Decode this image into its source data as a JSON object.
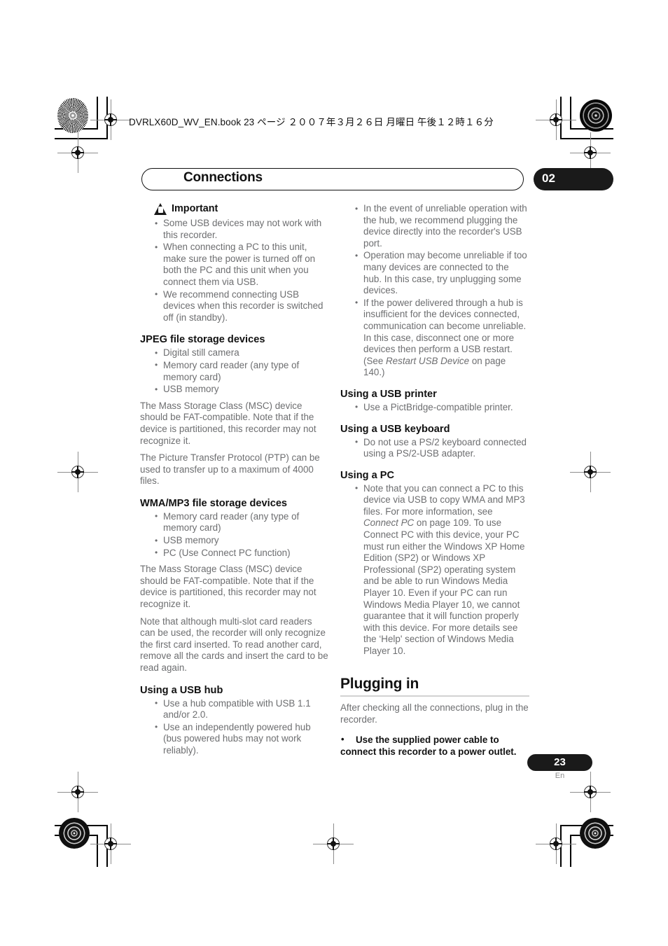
{
  "file_header": "DVRLX60D_WV_EN.book  23 ページ  ２００７年３月２６日   月曜日   午後１２時１６分",
  "chapter": {
    "title": "Connections",
    "number": "02"
  },
  "left_column": {
    "important": {
      "icon": "warning-triangle-icon",
      "label": "Important",
      "bullets": [
        "Some USB devices may not work with this recorder.",
        "When connecting a PC to this unit, make sure the power is turned off on both the PC and this unit when you connect them via USB.",
        "We recommend connecting USB devices when this recorder is switched off (in standby)."
      ]
    },
    "jpeg_section": {
      "heading": "JPEG file storage devices",
      "bullets": [
        "Digital still camera",
        "Memory card reader (any type of memory card)",
        "USB memory"
      ],
      "paragraphs": [
        "The Mass Storage Class (MSC) device should be FAT-compatible. Note that if the device is partitioned, this recorder may not recognize it.",
        "The Picture Transfer Protocol (PTP) can be used to transfer up to a maximum of 4000 files."
      ]
    },
    "wma_section": {
      "heading": "WMA/MP3 file storage devices",
      "bullets": [
        "Memory card reader (any type of memory card)",
        "USB memory",
        "PC (Use Connect PC function)"
      ],
      "paragraphs": [
        "The Mass Storage Class (MSC) device should be FAT-compatible. Note that if the device is partitioned, this recorder may not recognize it.",
        "Note that although multi-slot card readers can be used, the recorder will only recognize the first card inserted. To read another card, remove all the cards and insert the card to be read again."
      ]
    },
    "hub_section": {
      "heading": "Using a USB hub",
      "bullets": [
        "Use a hub compatible with USB 1.1 and/or 2.0.",
        "Use an independently powered hub (bus powered hubs may not work reliably)."
      ]
    }
  },
  "right_column": {
    "hub_bullets": [
      "In the event of unreliable operation with the hub, we recommend plugging the device directly into the recorder's USB port.",
      "Operation may become unreliable if too many devices are connected to the hub. In this case, try unplugging some devices."
    ],
    "hub_bullet_restart": {
      "text_before": "If the power delivered through a hub is insufficient for the devices connected, communication can become unreliable. In this case, disconnect one or more devices then perform a USB restart. (See ",
      "italic_ref": "Restart USB Device",
      "text_after": " on page 140.)"
    },
    "printer_section": {
      "heading": "Using a USB printer",
      "bullets": [
        "Use a PictBridge-compatible printer."
      ]
    },
    "keyboard_section": {
      "heading": "Using a USB keyboard",
      "bullets": [
        "Do not use a PS/2 keyboard connected using a PS/2-USB adapter."
      ]
    },
    "pc_section": {
      "heading": "Using a PC",
      "bullet": {
        "text_before": "Note that you can connect a PC to this device via USB to copy WMA and MP3 files. For more information, see ",
        "italic_ref": "Connect PC",
        "text_after": " on page 109. To use Connect PC with this device, your PC must run either the Windows XP Home Edition (SP2) or Windows XP Professional (SP2) operating system and be able to run Windows Media Player 10. Even if your PC can run Windows Media Player 10, we cannot guarantee that it will function properly with this device. For more details see the ‘Help' section of Windows Media Player 10."
      }
    },
    "plugging_section": {
      "heading": "Plugging in",
      "paragraph": "After checking all the connections, plug in the recorder.",
      "strong_bullet": "Use the supplied power cable to connect this recorder to a power outlet."
    }
  },
  "footer": {
    "page_number": "23",
    "language": "En"
  }
}
